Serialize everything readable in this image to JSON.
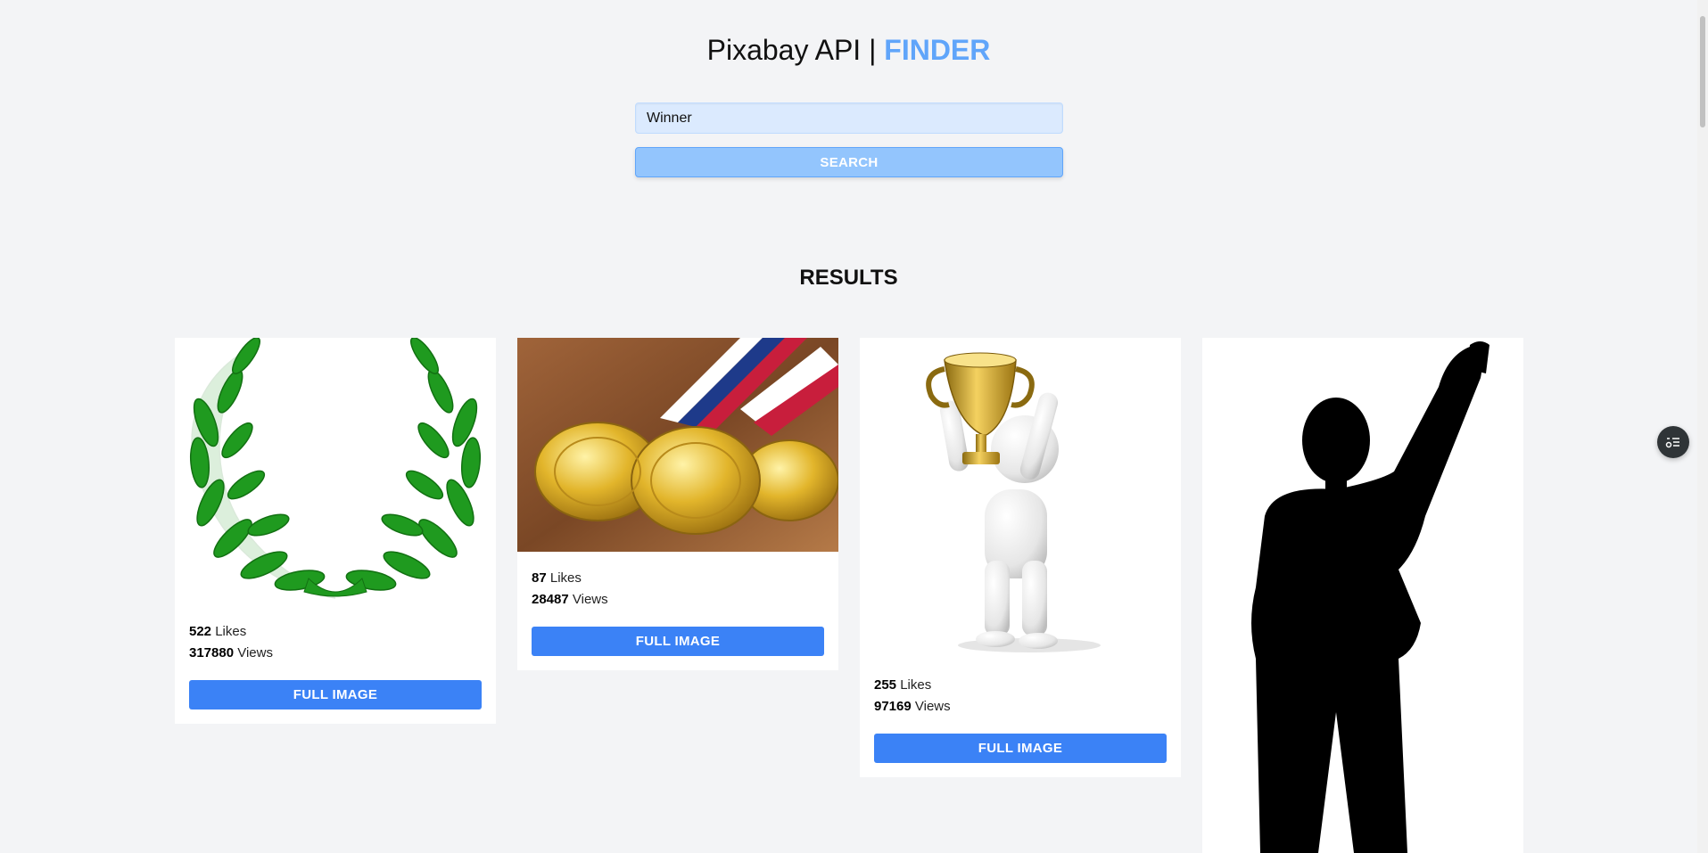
{
  "header": {
    "title_main": "Pixabay API | ",
    "title_accent": "FINDER"
  },
  "search": {
    "value": "Winner",
    "button_label": "SEARCH"
  },
  "results": {
    "heading": "RESULTS",
    "cards": [
      {
        "image": "laurel-wreath",
        "likes": "522",
        "likes_label": "Likes",
        "views": "317880",
        "views_label": "Views",
        "button_label": "FULL IMAGE"
      },
      {
        "image": "gold-medals",
        "likes": "87",
        "likes_label": "Likes",
        "views": "28487",
        "views_label": "Views",
        "button_label": "FULL IMAGE"
      },
      {
        "image": "trophy-figure",
        "likes": "255",
        "likes_label": "Likes",
        "views": "97169",
        "views_label": "Views",
        "button_label": "FULL IMAGE"
      },
      {
        "image": "winner-silhouette"
      }
    ]
  },
  "colors": {
    "accent": "#60a5fa",
    "button_primary": "#3b82f6",
    "background": "#f3f4f6"
  },
  "icons": {
    "floating_button": "settings-list-icon"
  }
}
